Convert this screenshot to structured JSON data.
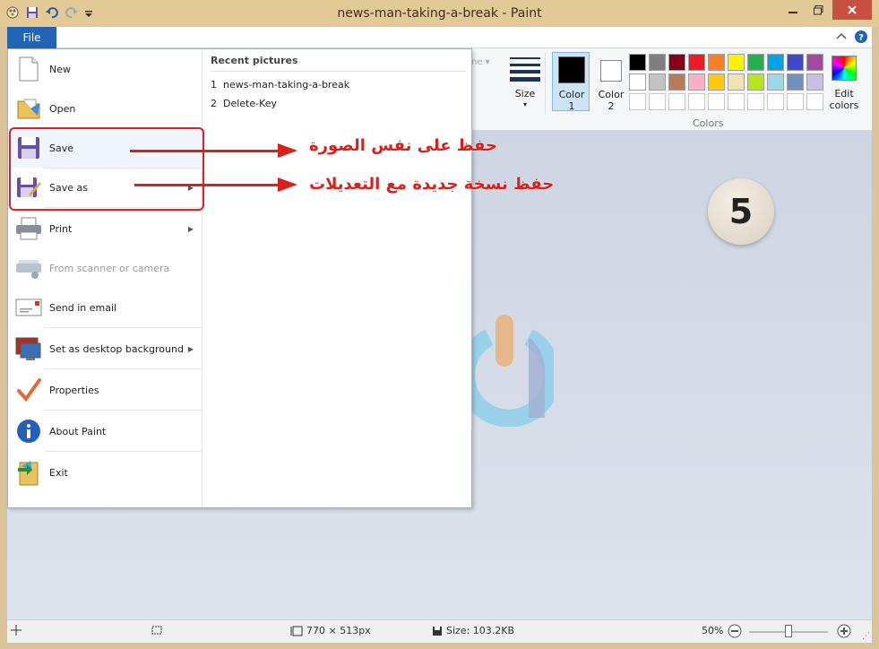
{
  "window": {
    "title": "news-man-taking-a-break - Paint",
    "minimize_icon": "minimize-icon",
    "maximize_icon": "maximize-icon",
    "close_icon": "close-icon"
  },
  "ribbon": {
    "file_tab": "File",
    "partial_label": "ne",
    "size_label": "Size",
    "color1_label": "Color",
    "color1_num": "1",
    "color2_label": "Color",
    "color2_num": "2",
    "edit_colors_line1": "Edit",
    "edit_colors_line2": "colors",
    "colors_group": "Colors",
    "palette_row1": [
      "#000000",
      "#7f7f7f",
      "#880015",
      "#ed1c24",
      "#ff7f27",
      "#fff200",
      "#22b14c",
      "#00a2e8",
      "#3f48cc",
      "#a349a4"
    ],
    "palette_row2": [
      "#ffffff",
      "#c3c3c3",
      "#b97a57",
      "#ffaec9",
      "#ffc90e",
      "#efe4b0",
      "#b5e61d",
      "#99d9ea",
      "#7092be",
      "#c8bfe7"
    ],
    "palette_row3": [
      "#ffffff",
      "#ffffff",
      "#ffffff",
      "#ffffff",
      "#ffffff",
      "#ffffff",
      "#ffffff",
      "#ffffff",
      "#ffffff",
      "#ffffff"
    ],
    "color1_value": "#000000",
    "color2_value": "#ffffff"
  },
  "file_menu": {
    "items": [
      {
        "label": "New",
        "icon": "new-file-icon"
      },
      {
        "label": "Open",
        "icon": "open-folder-icon"
      },
      {
        "label": "Save",
        "icon": "save-disk-icon"
      },
      {
        "label": "Save as",
        "icon": "save-as-icon"
      },
      {
        "label": "Print",
        "icon": "printer-icon"
      },
      {
        "label": "From scanner or camera",
        "icon": "scanner-icon"
      },
      {
        "label": "Send in email",
        "icon": "email-icon"
      },
      {
        "label": "Set as desktop background",
        "icon": "desktop-icon"
      },
      {
        "label": "Properties",
        "icon": "checkmark-icon"
      },
      {
        "label": "About Paint",
        "icon": "info-icon"
      },
      {
        "label": "Exit",
        "icon": "exit-icon"
      }
    ],
    "recent_title": "Recent pictures",
    "recent": [
      {
        "num": "1",
        "name": "news-man-taking-a-break"
      },
      {
        "num": "2",
        "name": "Delete-Key"
      }
    ]
  },
  "annotations": {
    "save_note": "حفظ على نفس الصورة",
    "save_as_note": "حفظ نسخة جديدة مع التعديلات",
    "step_number": "5",
    "accent": "#d8211d"
  },
  "status": {
    "dimensions": "770 × 513px",
    "size": "Size: 103.2KB",
    "zoom": "50%",
    "zoom_level": 0.5
  }
}
